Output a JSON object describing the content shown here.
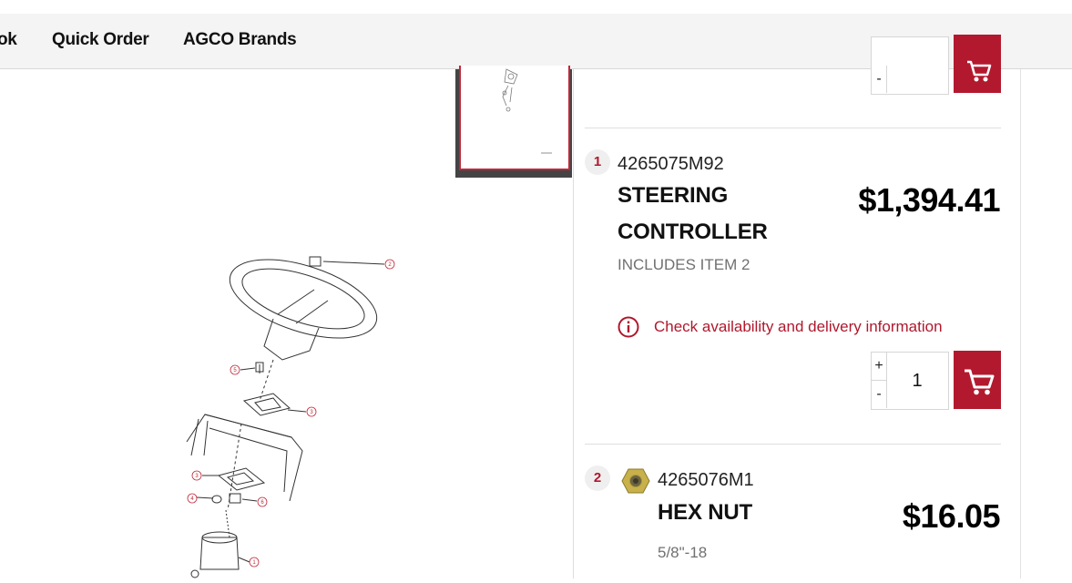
{
  "nav": {
    "partial_item": "ok",
    "items": [
      "Quick Order",
      "AGCO Brands"
    ]
  },
  "diagram": {
    "callouts": [
      "2",
      "5",
      "3",
      "3",
      "4",
      "6",
      "1"
    ]
  },
  "parts": [
    {
      "number": "1",
      "part_no": "4265075M92",
      "name_line1": "STEERING",
      "name_line2": "CONTROLLER",
      "note": "INCLUDES ITEM 2",
      "price": "$1,394.41",
      "availability": "Check availability and delivery information",
      "qty": "1"
    },
    {
      "number": "2",
      "part_no": "4265076M1",
      "name": "HEX NUT",
      "note": "5/8\"-18",
      "price": "$16.05"
    }
  ],
  "qty_controls": {
    "plus": "+",
    "minus": "-"
  },
  "colors": {
    "accent": "#b3192e",
    "nav_bg": "#f4f4f4"
  }
}
